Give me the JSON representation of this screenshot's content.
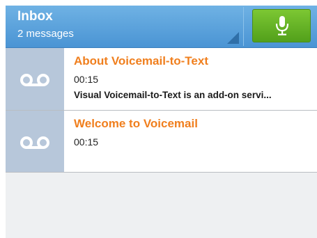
{
  "header": {
    "title": "Inbox",
    "subtitle": "2 messages",
    "mic_icon": "microphone-icon",
    "colors": {
      "header_blue": "#4a94d4",
      "mic_green": "#6ab82a"
    }
  },
  "messages": [
    {
      "title": "About Voicemail-to-Text",
      "duration": "00:15",
      "preview": "Visual Voicemail-to-Text is an add-on servi...",
      "icon": "voicemail-icon"
    },
    {
      "title": "Welcome to Voicemail",
      "duration": "00:15",
      "preview": "",
      "icon": "voicemail-icon"
    }
  ],
  "colors": {
    "title_orange": "#f07f1e",
    "icon_cell": "#b7c7da"
  }
}
